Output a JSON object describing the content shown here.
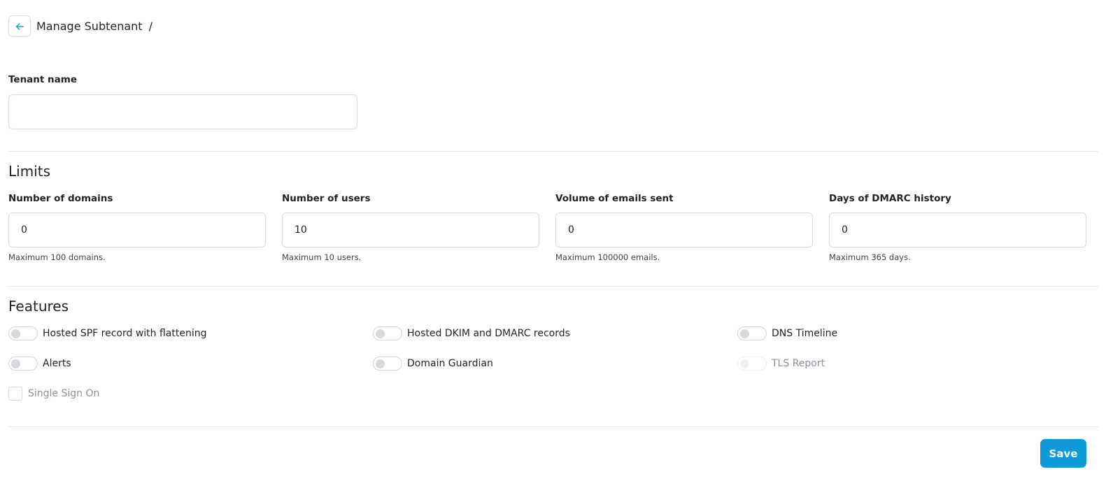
{
  "header": {
    "title": "Manage Subtenant",
    "separator": "/"
  },
  "tenant": {
    "label": "Tenant name",
    "value": "",
    "placeholder": ""
  },
  "limits": {
    "title": "Limits",
    "fields": [
      {
        "label": "Number of domains",
        "value": "0",
        "help": "Maximum 100 domains."
      },
      {
        "label": "Number of users",
        "value": "10",
        "help": "Maximum 10 users."
      },
      {
        "label": "Volume of emails sent",
        "value": "0",
        "help": "Maximum 100000 emails."
      },
      {
        "label": "Days of DMARC history",
        "value": "0",
        "help": "Maximum 365 days."
      }
    ]
  },
  "features": {
    "title": "Features",
    "items": [
      {
        "label": "Hosted SPF record with flattening",
        "enabled": false,
        "disabled": false
      },
      {
        "label": "Hosted DKIM and DMARC records",
        "enabled": false,
        "disabled": false
      },
      {
        "label": "DNS Timeline",
        "enabled": false,
        "disabled": false
      },
      {
        "label": "Alerts",
        "enabled": false,
        "disabled": false
      },
      {
        "label": "Domain Guardian",
        "enabled": false,
        "disabled": false
      },
      {
        "label": "TLS Report",
        "enabled": false,
        "disabled": true
      }
    ],
    "sso": {
      "label": "Single Sign On",
      "checked": false
    }
  },
  "actions": {
    "save_label": "Save"
  },
  "colors": {
    "accent": "#0f9ad7",
    "back_arrow": "#1a9bd7"
  },
  "icons": {
    "back": "arrow-left-icon"
  }
}
